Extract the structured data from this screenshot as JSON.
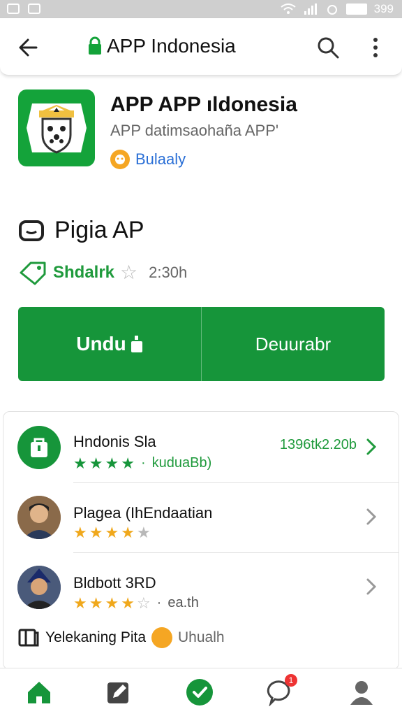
{
  "status_bar": {
    "time": "399"
  },
  "header": {
    "title": "APP Indonesia"
  },
  "app": {
    "name": "APP APP ıldonesia",
    "subtitle": "APP datimsaohaña APP'",
    "developer": "Bulaaly",
    "brand_color": "#14a33a"
  },
  "section": {
    "title": "Pigia AP",
    "rating_label": "Shdalrk",
    "rating_count": "2:30h"
  },
  "buttons": {
    "primary_label": "Undu",
    "secondary_label": "Deuurabr",
    "accent": "#16953a"
  },
  "list": {
    "items": [
      {
        "title": "Hndonis Sla",
        "stars": [
          1,
          1,
          1,
          1
        ],
        "sub": "kuduaBb)",
        "meta": "1396tk2.20b",
        "avatar": "shop-icon"
      },
      {
        "title": "Plagea (IhEndaatian",
        "stars": [
          1,
          1,
          1,
          0.5,
          0
        ],
        "sub": "",
        "meta": "",
        "avatar": "person-avatar"
      },
      {
        "title": "Bldbott 3RD",
        "stars": [
          1,
          1,
          1,
          0.5,
          0
        ],
        "sub": "ea.th",
        "meta": "",
        "avatar": "person-avatar"
      }
    ],
    "footer": {
      "label": "Yelekaning Pita",
      "muted": "Uhualh"
    }
  },
  "bottom_nav": {
    "items": [
      "home-icon",
      "edit-icon",
      "check-icon",
      "chat-icon",
      "profile-icon"
    ],
    "chat_badge": "1"
  }
}
